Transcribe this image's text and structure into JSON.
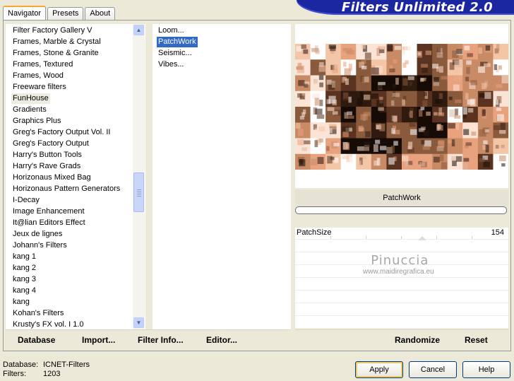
{
  "banner": {
    "title": "Filters Unlimited 2.0"
  },
  "tabs": [
    {
      "label": "Navigator",
      "active": true
    },
    {
      "label": "Presets",
      "active": false
    },
    {
      "label": "About",
      "active": false
    }
  ],
  "categories": [
    "Filter Factory Gallery V",
    "Frames, Marble & Crystal",
    "Frames, Stone & Granite",
    "Frames, Textured",
    "Frames, Wood",
    "Freeware filters",
    "FunHouse",
    "Gradients",
    "Graphics Plus",
    "Greg's Factory Output Vol. II",
    "Greg's Factory Output",
    "Harry's Button Tools",
    "Harry's Rave Grads",
    "Horizonaus Mixed Bag",
    "Horizonaus Pattern Generators",
    "I-Decay",
    "Image Enhancement",
    "It@lian Editors Effect",
    "Jeux de lignes",
    "Johann's Filters",
    "kang 1",
    "kang 2",
    "kang 3",
    "kang 4",
    "kang",
    "Kohan's Filters",
    "Krusty's FX vol. I 1.0"
  ],
  "selected_category": "FunHouse",
  "filters": [
    "Loom...",
    "PatchWork",
    "Seismic...",
    "Vibes..."
  ],
  "selected_filter": "PatchWork",
  "toolbar": {
    "database": "Database",
    "import": "Import...",
    "filter_info": "Filter Info...",
    "editor": "Editor...",
    "randomize": "Randomize",
    "reset": "Reset"
  },
  "preview": {
    "filter_name": "PatchWork",
    "watermark_name": "Pinuccia",
    "watermark_url": "www.maidiregrafica.eu"
  },
  "params": [
    {
      "label": "PatchSize",
      "value": "154"
    }
  ],
  "footer": {
    "database_label": "Database:",
    "database_value": "ICNET-Filters",
    "filters_label": "Filters:",
    "filters_value": "1203"
  },
  "buttons": {
    "apply": "Apply",
    "cancel": "Cancel",
    "help": "Help"
  },
  "colors": {
    "banner": "#1b27a0",
    "selection": "#316ac5",
    "dialog_bg": "#ece9d8"
  }
}
